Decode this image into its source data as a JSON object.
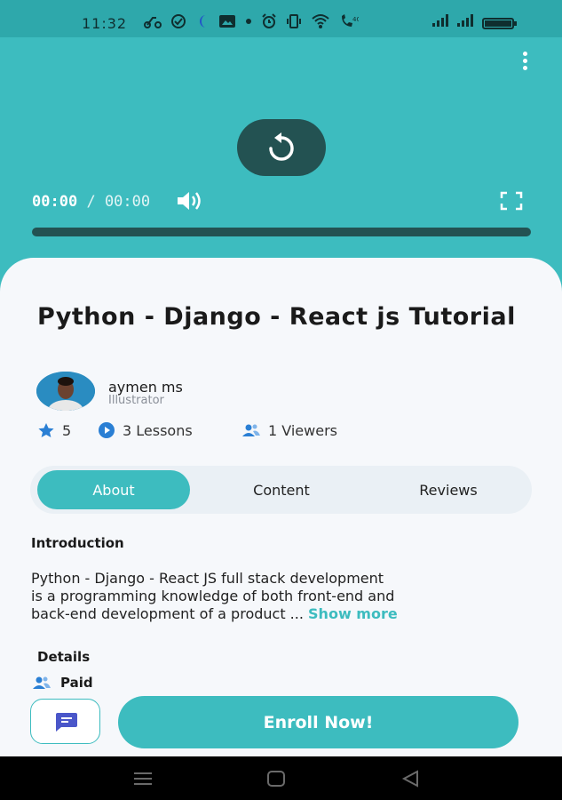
{
  "status_bar": {
    "time": "11:32",
    "icons": [
      "scooter-icon",
      "clock-check-icon",
      "moon-icon",
      "image-icon",
      "dot-icon",
      "alarm-icon",
      "vibrate-icon",
      "wifi-icon",
      "call-icon",
      "signal-icon",
      "signal-icon",
      "battery-icon"
    ]
  },
  "player": {
    "current_time": "00:00",
    "separator": "/",
    "duration": "00:00",
    "progress": 0
  },
  "course": {
    "title": "Python - Django - React js Tutorial",
    "author_name": "aymen ms",
    "author_role": "Illustrator",
    "rating": "5",
    "lessons": "3 Lessons",
    "viewers": "1 Viewers"
  },
  "tabs": {
    "about": "About",
    "content": "Content",
    "reviews": "Reviews",
    "active": "About"
  },
  "introduction": {
    "heading": "Introduction",
    "text_line1": "Python - Django - React JS full stack development",
    "text_line2": "is a programming knowledge of both front-end and",
    "text_line3": "back-end development of a product ...",
    "show_more": "Show more"
  },
  "details": {
    "heading": "Details",
    "price_type": "Paid"
  },
  "actions": {
    "enroll_label": "Enroll Now!"
  },
  "colors": {
    "accent": "#3dbcbf",
    "dark_teal": "#235252",
    "status_bar": "#2ea8ab",
    "star": "#2a7fd4",
    "chat_icon": "#4a56c9"
  }
}
